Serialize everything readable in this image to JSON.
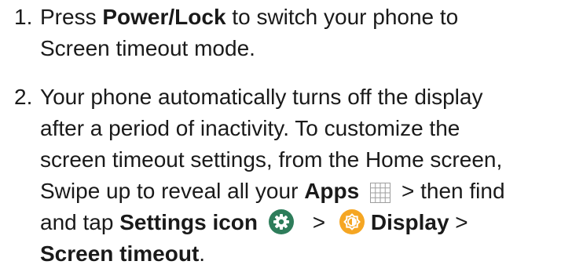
{
  "steps": [
    {
      "number": "1.",
      "lines": [
        {
          "pre": "Press ",
          "bold": "Power/Lock",
          "post": " to switch your phone to"
        },
        {
          "text": "Screen timeout mode."
        }
      ]
    },
    {
      "number": "2.",
      "lines": [
        {
          "text": "Your phone automatically turns off the display"
        },
        {
          "text": "after a period of inactivity. To customize the"
        },
        {
          "text": "screen timeout settings, from the Home screen,"
        },
        {
          "pre": "Swipe up to reveal all your ",
          "bold": "Apps",
          "post": " > then find"
        },
        {
          "pre": "and tap ",
          "bold": "Settings icon",
          "mid": " > ",
          "bold2": "Display",
          "post": " >"
        },
        {
          "bold": "Screen timeout",
          "post": "."
        }
      ]
    }
  ],
  "icons": {
    "apps": "apps-grid-icon",
    "settings": "settings-gear-icon",
    "display": "display-brightness-icon"
  },
  "colors": {
    "text": "#1a1a1a",
    "settings_icon_bg": "#2e7d5b",
    "display_icon_bg": "#f5a623",
    "apps_grid": "#9e9e9e"
  }
}
